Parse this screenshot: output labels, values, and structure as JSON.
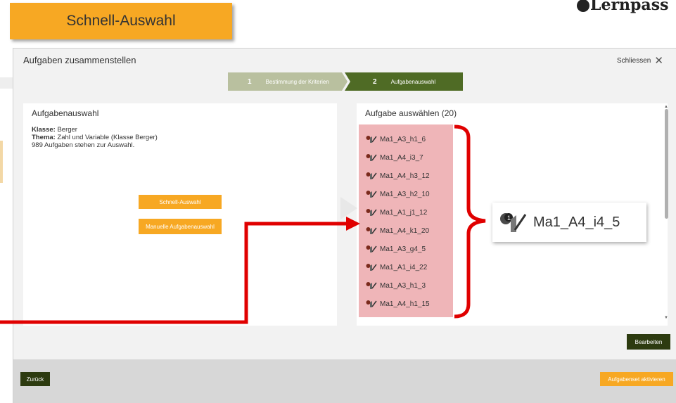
{
  "badge": {
    "label": "Schnell-Auswahl"
  },
  "brand": {
    "text": "Lernpass"
  },
  "dialog": {
    "title": "Aufgaben zusammenstellen",
    "close_label": "Schliessen",
    "steps": [
      {
        "num": "1",
        "label": "Bestimmung der Kriterien"
      },
      {
        "num": "2",
        "label": "Aufgabenauswahl"
      }
    ]
  },
  "left_panel": {
    "title": "Aufgabenauswahl",
    "klasse_label": "Klasse:",
    "klasse_value": " Berger",
    "thema_label": "Thema:",
    "thema_value": " Zahl und Variable (Klasse Berger)",
    "count_text": "989 Aufgaben stehen zur Auswahl.",
    "quick_button": "Schnell-Auswahl",
    "manual_button": "Manuelle Aufgabenauswahl"
  },
  "right_panel": {
    "title": "Aufgabe auswählen (20)",
    "tasks": [
      "Ma1_A3_h1_6",
      "Ma1_A4_i3_7",
      "Ma1_A4_h3_12",
      "Ma1_A3_h2_10",
      "Ma1_A1_j1_12",
      "Ma1_A4_k1_20",
      "Ma1_A3_g4_5",
      "Ma1_A1_i4_22",
      "Ma1_A3_h1_3",
      "Ma1_A4_h1_15"
    ]
  },
  "callout": {
    "task_label": "Ma1_A4_i4_5"
  },
  "buttons": {
    "edit": "Bearbeiten",
    "back": "Zurück",
    "activate": "Aufgabenset aktivieren"
  },
  "colors": {
    "orange": "#f7a823",
    "dark_green": "#2d3b10",
    "step_done": "#b9c09f",
    "step_active": "#4f6b25",
    "highlight": "#e2787d",
    "annotation_red": "#e00000"
  },
  "icons": {
    "task": "task-edit-icon",
    "close": "close-icon"
  }
}
